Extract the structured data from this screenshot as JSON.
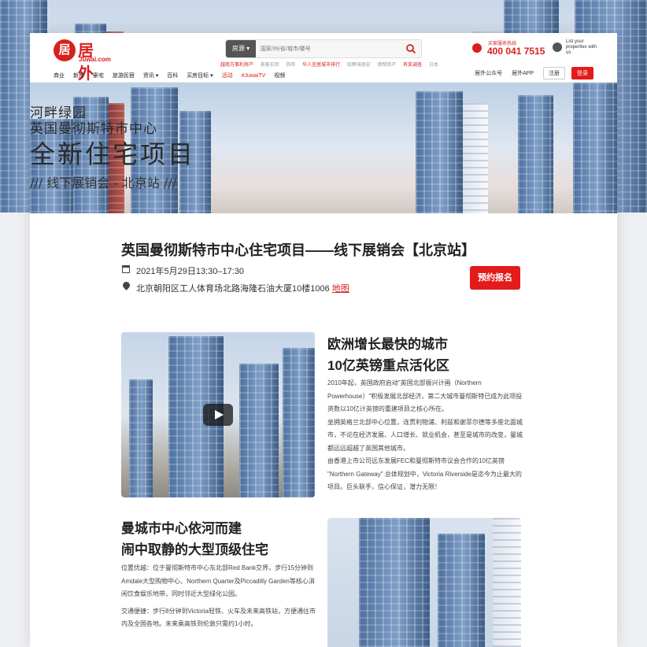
{
  "brand": {
    "logo_char": "居",
    "name": "居外",
    "sub": "Juwai.com"
  },
  "search": {
    "select_label": "房源 ▾",
    "placeholder": "国家/州/省/城市/楼号"
  },
  "hot_links": [
    "越南万事利房产",
    "美客实验",
    "热柜",
    "华人宜居城市排行",
    "招聘海居宏",
    "德帮房产",
    "有奖调查",
    "日本"
  ],
  "hotline": {
    "label": "买家服务热线",
    "number": "400 041 7515"
  },
  "list_props": "List your properties with us",
  "nav": [
    "商业",
    "新房",
    "豪宅",
    "旅游民宿",
    "资讯 ▾",
    "百科",
    "买房目标 ▾",
    "活动",
    "#JuwaiTV",
    "视频"
  ],
  "nav_right": {
    "wechat": "居外公众号",
    "app": "居外APP",
    "login": "注册",
    "register": "登录"
  },
  "banner": {
    "line1": "河畔绿园",
    "line2": "英国曼彻斯特市中心",
    "line3": "全新住宅项目",
    "line4": "/// 线下展销会 - 北京站 ///"
  },
  "event": {
    "title": "英国曼彻斯特市中心住宅项目——线下展销会【北京站】",
    "date": "2021年5月29日13:30–17:30",
    "address": "北京朝阳区工人体育场北路海隆石油大厦10楼1006",
    "map_link": "地图",
    "reserve": "预约报名"
  },
  "section1": {
    "heading_line1": "欧洲增长最快的城市",
    "heading_line2": "10亿英镑重点活化区",
    "paragraphs": [
      "2010年起，英国政府启动\"英国北部振兴计画（Northern Powerhouse）\"积极发展北部经济，第二大城市曼彻斯特已成为此项投资数以10亿计英镑的重建项目之核心所在。",
      "坐拥英格兰北部中心位置，连贯利物浦、利兹和谢菲尔德等多座北面城市，不论在经济发展、人口增长、就业机会，甚至是城市的改变，曼城都远远超越了英国其他城市。",
      "由香港上市公司远东发展FEC和曼彻斯特市议会合作的10亿英镑 \"Northern Gateway\" 总体规划中，Victoria Riverside是迄今为止最大的项目。巨头联手，信心保证，潜力无限！"
    ]
  },
  "section2": {
    "heading_line1": "曼城市中心依河而建",
    "heading_line2": "闹中取静的大型顶级住宅",
    "paragraphs": [
      "位置优越：位于曼彻斯特市中心东北部Red Bank交界，步行15分钟到Amdale大型购物中心、Northern Quarter及Piccadilly Garden等核心消闲饮食娱乐地带，同时邻近大型绿化公园。",
      "交通便捷：步行8分钟到Victoria轻铁、火车及未来高铁站，方便通往市内及全国各地。未来乘高铁到伦敦只需约1小时。"
    ]
  }
}
